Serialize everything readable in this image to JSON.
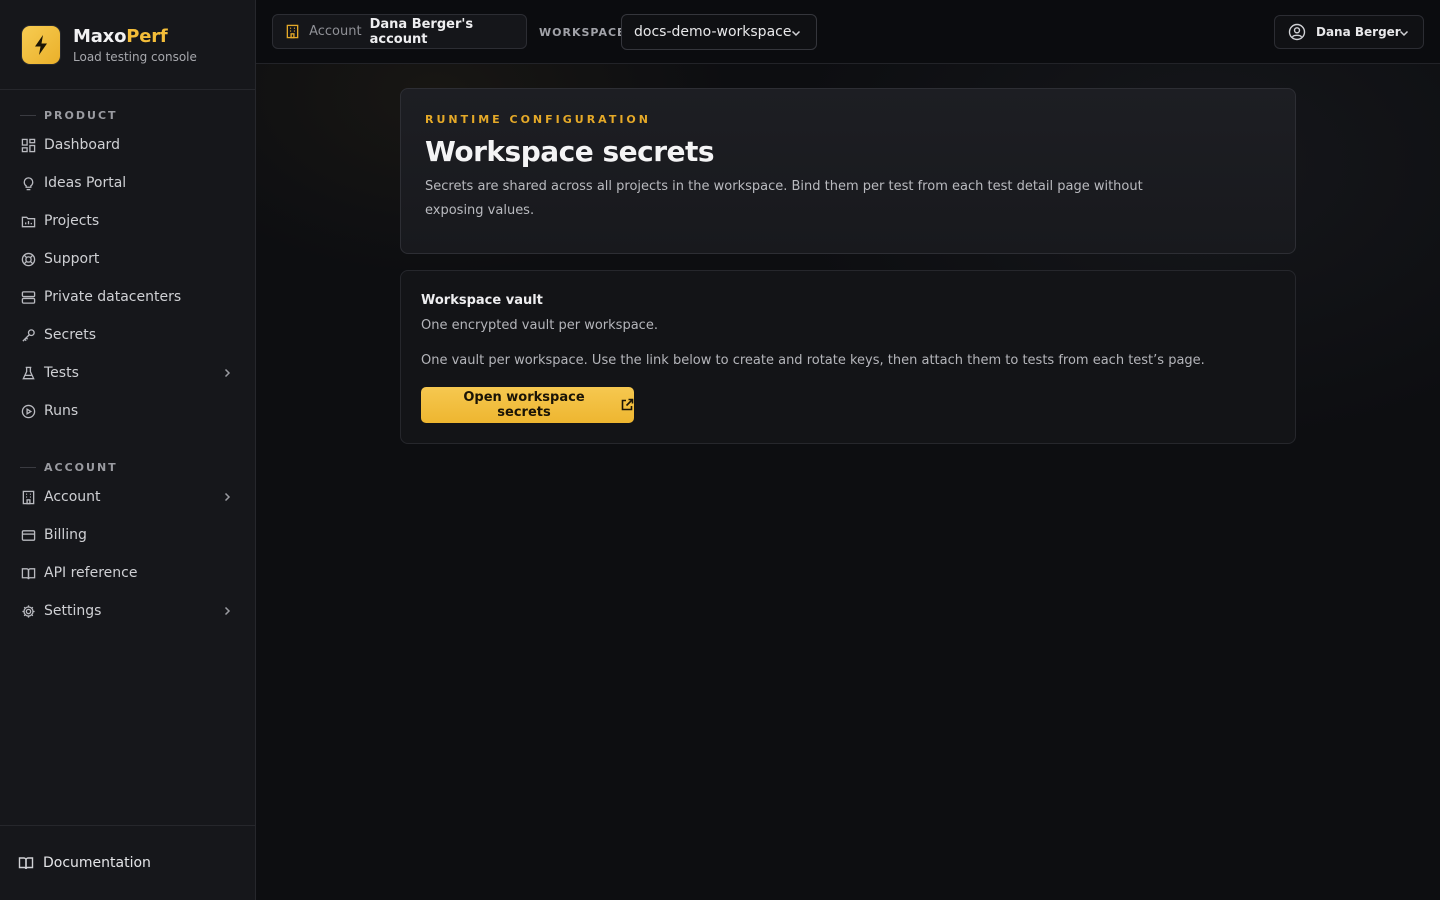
{
  "brand": {
    "name_main": "Maxo",
    "name_accent": "Perf",
    "subtitle": "Load testing console",
    "accent": "#f3bd39"
  },
  "sidebar": {
    "product_header": "PRODUCT",
    "product_items": [
      {
        "label": "Dashboard",
        "icon": "dashboard-icon"
      },
      {
        "label": "Ideas Portal",
        "icon": "lightbulb-icon"
      },
      {
        "label": "Projects",
        "icon": "folder-chart-icon"
      },
      {
        "label": "Support",
        "icon": "lifebuoy-icon"
      },
      {
        "label": "Private datacenters",
        "icon": "server-icon"
      },
      {
        "label": "Secrets",
        "icon": "key-icon"
      },
      {
        "label": "Tests",
        "icon": "flask-icon",
        "expandable": true
      },
      {
        "label": "Runs",
        "icon": "play-circle-icon"
      }
    ],
    "account_header": "ACCOUNT",
    "account_items": [
      {
        "label": "Account",
        "icon": "building-icon",
        "expandable": true
      },
      {
        "label": "Billing",
        "icon": "credit-card-icon"
      },
      {
        "label": "API reference",
        "icon": "book-icon"
      },
      {
        "label": "Settings",
        "icon": "gear-icon",
        "expandable": true
      }
    ],
    "footer_label": "Documentation"
  },
  "topbar": {
    "account_key": "Account",
    "account_value": "Dana Berger's account",
    "workspace_label": "WORKSPACE",
    "workspace_selected": "docs-demo-workspace",
    "user_name": "Dana Berger"
  },
  "hero": {
    "eyebrow": "RUNTIME CONFIGURATION",
    "title": "Workspace secrets",
    "description": "Secrets are shared across all projects in the workspace. Bind them per test from each test detail page without exposing values."
  },
  "vault": {
    "title": "Workspace vault",
    "subtitle": "One encrypted vault per workspace.",
    "description": "One vault per workspace. Use the link below to create and rotate keys, then attach them to tests from each test’s page.",
    "button_label": "Open workspace secrets"
  }
}
